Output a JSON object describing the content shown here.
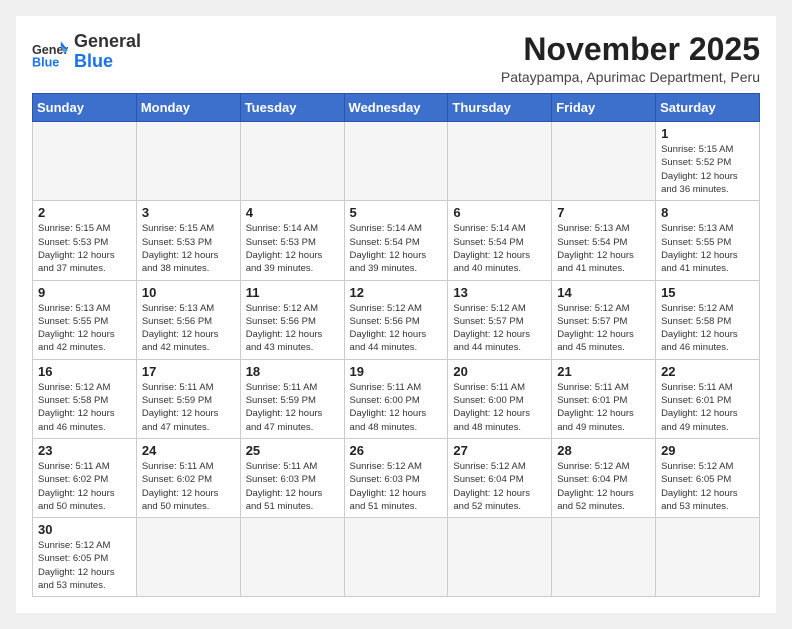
{
  "logo": {
    "general": "General",
    "blue": "Blue"
  },
  "header": {
    "month": "November 2025",
    "location": "Pataypampa, Apurimac Department, Peru"
  },
  "weekdays": [
    "Sunday",
    "Monday",
    "Tuesday",
    "Wednesday",
    "Thursday",
    "Friday",
    "Saturday"
  ],
  "days": {
    "1": {
      "sunrise": "5:15 AM",
      "sunset": "5:52 PM",
      "daylight": "12 hours and 36 minutes."
    },
    "2": {
      "sunrise": "5:15 AM",
      "sunset": "5:53 PM",
      "daylight": "12 hours and 37 minutes."
    },
    "3": {
      "sunrise": "5:15 AM",
      "sunset": "5:53 PM",
      "daylight": "12 hours and 38 minutes."
    },
    "4": {
      "sunrise": "5:14 AM",
      "sunset": "5:53 PM",
      "daylight": "12 hours and 39 minutes."
    },
    "5": {
      "sunrise": "5:14 AM",
      "sunset": "5:54 PM",
      "daylight": "12 hours and 39 minutes."
    },
    "6": {
      "sunrise": "5:14 AM",
      "sunset": "5:54 PM",
      "daylight": "12 hours and 40 minutes."
    },
    "7": {
      "sunrise": "5:13 AM",
      "sunset": "5:54 PM",
      "daylight": "12 hours and 41 minutes."
    },
    "8": {
      "sunrise": "5:13 AM",
      "sunset": "5:55 PM",
      "daylight": "12 hours and 41 minutes."
    },
    "9": {
      "sunrise": "5:13 AM",
      "sunset": "5:55 PM",
      "daylight": "12 hours and 42 minutes."
    },
    "10": {
      "sunrise": "5:13 AM",
      "sunset": "5:56 PM",
      "daylight": "12 hours and 42 minutes."
    },
    "11": {
      "sunrise": "5:12 AM",
      "sunset": "5:56 PM",
      "daylight": "12 hours and 43 minutes."
    },
    "12": {
      "sunrise": "5:12 AM",
      "sunset": "5:56 PM",
      "daylight": "12 hours and 44 minutes."
    },
    "13": {
      "sunrise": "5:12 AM",
      "sunset": "5:57 PM",
      "daylight": "12 hours and 44 minutes."
    },
    "14": {
      "sunrise": "5:12 AM",
      "sunset": "5:57 PM",
      "daylight": "12 hours and 45 minutes."
    },
    "15": {
      "sunrise": "5:12 AM",
      "sunset": "5:58 PM",
      "daylight": "12 hours and 46 minutes."
    },
    "16": {
      "sunrise": "5:12 AM",
      "sunset": "5:58 PM",
      "daylight": "12 hours and 46 minutes."
    },
    "17": {
      "sunrise": "5:11 AM",
      "sunset": "5:59 PM",
      "daylight": "12 hours and 47 minutes."
    },
    "18": {
      "sunrise": "5:11 AM",
      "sunset": "5:59 PM",
      "daylight": "12 hours and 47 minutes."
    },
    "19": {
      "sunrise": "5:11 AM",
      "sunset": "6:00 PM",
      "daylight": "12 hours and 48 minutes."
    },
    "20": {
      "sunrise": "5:11 AM",
      "sunset": "6:00 PM",
      "daylight": "12 hours and 48 minutes."
    },
    "21": {
      "sunrise": "5:11 AM",
      "sunset": "6:01 PM",
      "daylight": "12 hours and 49 minutes."
    },
    "22": {
      "sunrise": "5:11 AM",
      "sunset": "6:01 PM",
      "daylight": "12 hours and 49 minutes."
    },
    "23": {
      "sunrise": "5:11 AM",
      "sunset": "6:02 PM",
      "daylight": "12 hours and 50 minutes."
    },
    "24": {
      "sunrise": "5:11 AM",
      "sunset": "6:02 PM",
      "daylight": "12 hours and 50 minutes."
    },
    "25": {
      "sunrise": "5:11 AM",
      "sunset": "6:03 PM",
      "daylight": "12 hours and 51 minutes."
    },
    "26": {
      "sunrise": "5:12 AM",
      "sunset": "6:03 PM",
      "daylight": "12 hours and 51 minutes."
    },
    "27": {
      "sunrise": "5:12 AM",
      "sunset": "6:04 PM",
      "daylight": "12 hours and 52 minutes."
    },
    "28": {
      "sunrise": "5:12 AM",
      "sunset": "6:04 PM",
      "daylight": "12 hours and 52 minutes."
    },
    "29": {
      "sunrise": "5:12 AM",
      "sunset": "6:05 PM",
      "daylight": "12 hours and 53 minutes."
    },
    "30": {
      "sunrise": "5:12 AM",
      "sunset": "6:05 PM",
      "daylight": "12 hours and 53 minutes."
    }
  }
}
